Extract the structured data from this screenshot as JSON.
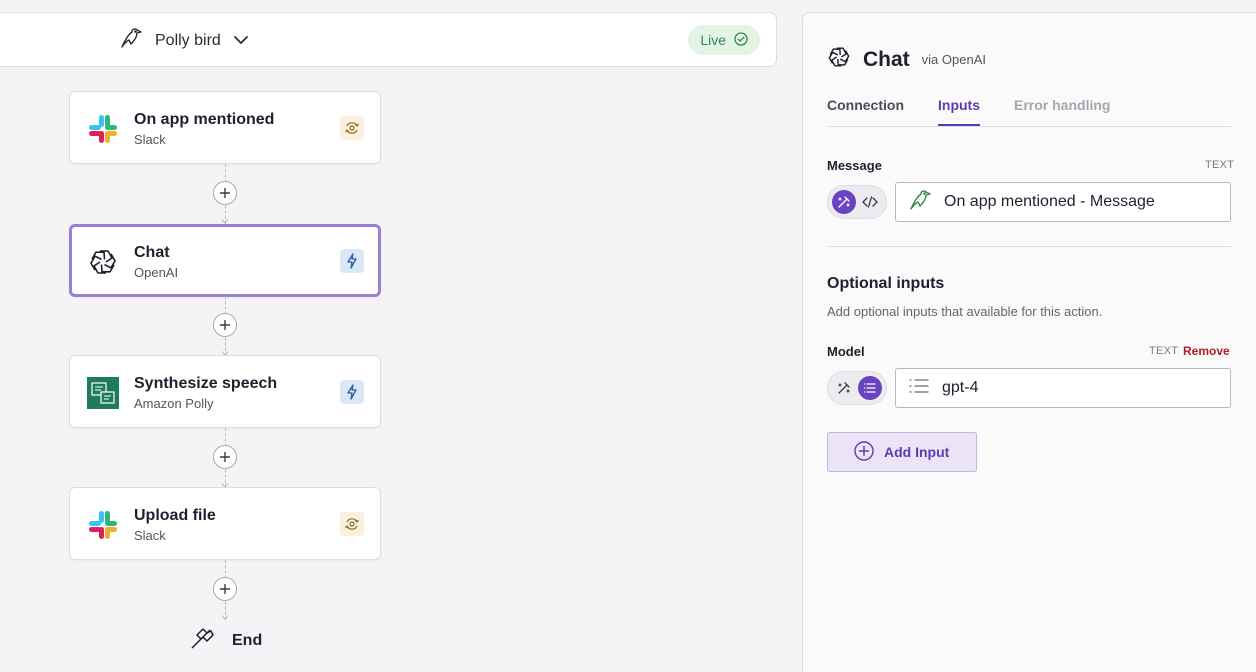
{
  "topbar": {
    "flow_name": "Polly bird",
    "status": "Live"
  },
  "nodes": [
    {
      "title": "On app mentioned",
      "subtitle": "Slack",
      "logo": "slack-logo",
      "badge": "trigger-icon"
    },
    {
      "title": "Chat",
      "subtitle": "OpenAI",
      "logo": "openai-logo",
      "badge": "lightning-icon"
    },
    {
      "title": "Synthesize speech",
      "subtitle": "Amazon Polly",
      "logo": "amazon-polly-logo",
      "badge": "lightning-icon"
    },
    {
      "title": "Upload file",
      "subtitle": "Slack",
      "logo": "slack-logo",
      "badge": "trigger-icon"
    }
  ],
  "end_label": "End",
  "panel": {
    "title": "Chat",
    "via": "via OpenAI",
    "tabs": [
      {
        "label": "Connection",
        "state": "normal"
      },
      {
        "label": "Inputs",
        "state": "active"
      },
      {
        "label": "Error handling",
        "state": "disabled"
      }
    ],
    "message": {
      "label": "Message",
      "type": "TEXT",
      "value": "On app mentioned - Message"
    },
    "optional": {
      "title": "Optional inputs",
      "description": "Add optional inputs that available for this action."
    },
    "model": {
      "label": "Model",
      "type": "TEXT",
      "remove_label": "Remove",
      "value": "gpt-4"
    },
    "add_input_label": "Add Input"
  },
  "colors": {
    "accent": "#5f3bb0",
    "selected_border": "#9b7fd4",
    "live_bg": "#e3f3e6",
    "live_text": "#2f8a45",
    "remove": "#b01e2c"
  }
}
